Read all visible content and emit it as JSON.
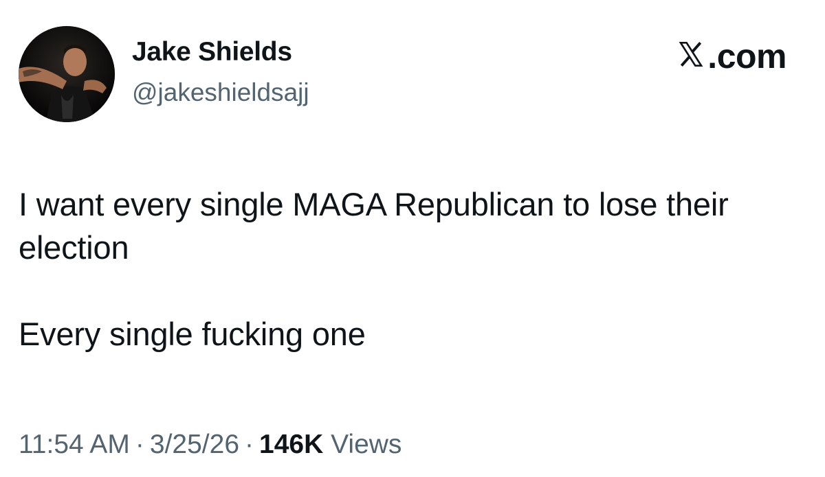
{
  "author": {
    "display_name": "Jake Shields",
    "handle": "@jakeshieldsajj"
  },
  "brand": {
    "label": ".com",
    "icon": "x-logo-icon"
  },
  "post": {
    "paragraphs": [
      "I want every single MAGA Republican to lose their election",
      "Every single fucking one"
    ]
  },
  "meta": {
    "time": "11:54 AM",
    "separator": "·",
    "date": "3/25/26",
    "views_count": "146K",
    "views_label": "Views"
  },
  "colors": {
    "text_primary": "#0f1419",
    "text_secondary": "#536471",
    "background": "#ffffff"
  }
}
